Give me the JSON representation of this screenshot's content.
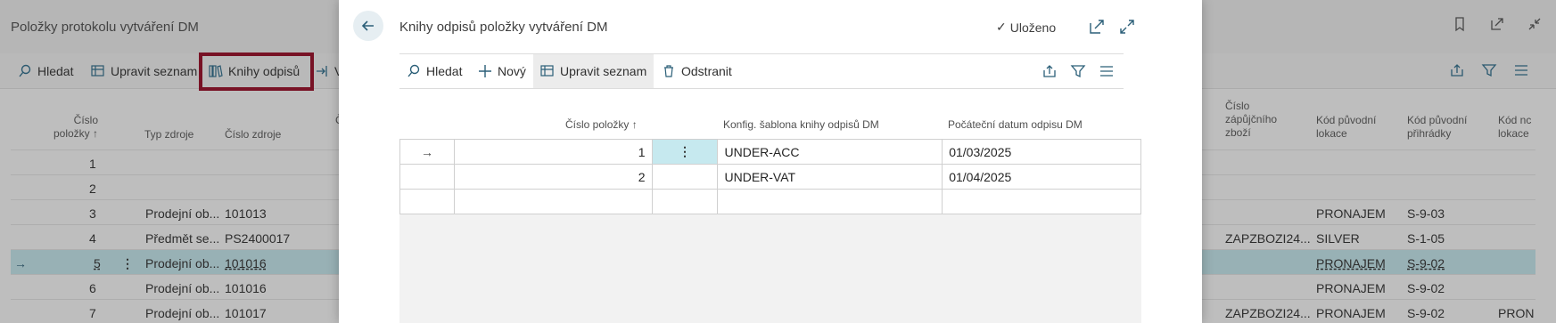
{
  "background": {
    "title": "Položky protokolu vytváření DM",
    "toolbar": {
      "search": "Hledat",
      "edit_list": "Upravit seznam",
      "books": "Knihy odpisů",
      "partial": "V"
    },
    "columns": {
      "item_no": "Číslo položky ↑",
      "source_type": "Typ zdroje",
      "source_no": "Číslo zdroje",
      "partial_c": "Č",
      "loan_item_no": "Číslo zápůjčního zboží",
      "orig_location": "Kód původní lokace",
      "orig_bin": "Kód původní přihrádky",
      "partial_code": "Kód nc lokace"
    },
    "rows": [
      {
        "no": "1",
        "type": "",
        "source": "",
        "loan": "",
        "loc": "",
        "bin": "",
        "extra": ""
      },
      {
        "no": "2",
        "type": "",
        "source": "",
        "loan": "",
        "loc": "",
        "bin": "",
        "extra": ""
      },
      {
        "no": "3",
        "type": "Prodejní ob...",
        "source": "101013",
        "loan": "",
        "loc": "PRONAJEM",
        "bin": "S-9-03",
        "extra": ""
      },
      {
        "no": "4",
        "type": "Předmět se...",
        "source": "PS2400017",
        "loan": "ZAPZBOZI24...",
        "loc": "SILVER",
        "bin": "S-1-05",
        "extra": ""
      },
      {
        "no": "5",
        "type": "Prodejní ob...",
        "source": "101016",
        "loan": "",
        "loc": "PRONAJEM",
        "bin": "S-9-02",
        "extra": ""
      },
      {
        "no": "6",
        "type": "Prodejní ob...",
        "source": "101016",
        "loan": "",
        "loc": "PRONAJEM",
        "bin": "S-9-02",
        "extra": ""
      },
      {
        "no": "7",
        "type": "Prodejní ob...",
        "source": "101017",
        "loan": "ZAPZBOZI24...",
        "loc": "PRONAJEM",
        "bin": "S-9-02",
        "extra": "PRON"
      }
    ],
    "selected_row_index": 4
  },
  "modal": {
    "title": "Knihy odpisů položky vytváření DM",
    "saved_label": "Uloženo",
    "toolbar": {
      "search": "Hledat",
      "new": "Nový",
      "edit_list": "Upravit seznam",
      "delete": "Odstranit"
    },
    "columns": {
      "item_no": "Číslo položky ↑",
      "template": "Konfig. šablona knihy odpisů DM",
      "start_date": "Počáteční datum odpisu DM"
    },
    "rows": [
      {
        "no": "1",
        "template": "UNDER-ACC",
        "date": "01/03/2025"
      },
      {
        "no": "2",
        "template": "UNDER-VAT",
        "date": "01/04/2025"
      }
    ]
  },
  "colors": {
    "highlight_border": "#9b0a24",
    "selected_row": "#c9ecf2",
    "accent": "#2b5f78"
  }
}
